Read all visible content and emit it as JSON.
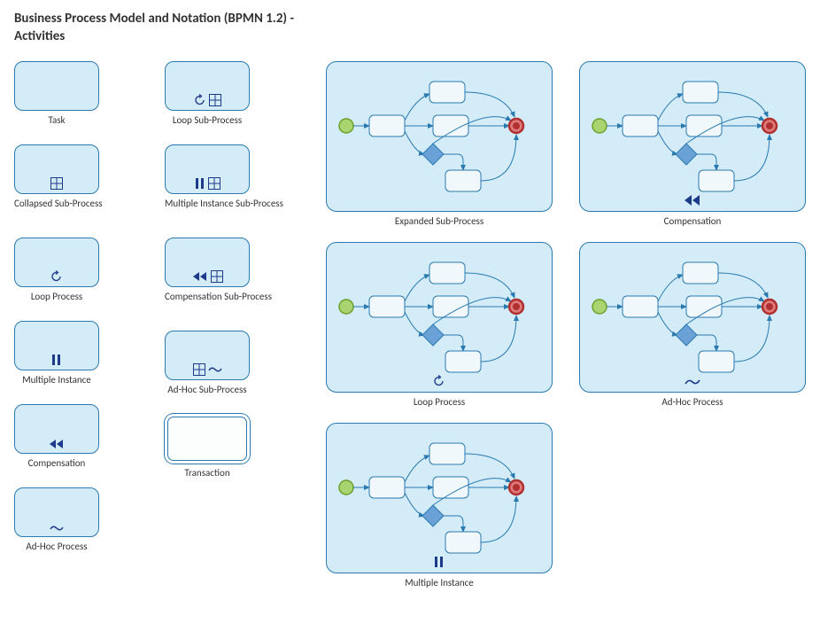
{
  "title_line1": "Business Process Model and Notation (BPMN 1.2) -",
  "title_line2": "Activities",
  "col1": {
    "task": "Task",
    "collapsed_sub": "Collapsed Sub-Process",
    "loop_process": "Loop Process",
    "multi_instance": "Multiple Instance",
    "compensation": "Compensation",
    "adhoc_process": "Ad-Hoc Process"
  },
  "col2": {
    "loop_sub": "Loop Sub-Process",
    "multi_instance_sub": "Multiple Instance Sub-Process",
    "compensation_sub": "Compensation Sub-Process",
    "adhoc_sub": "Ad-Hoc Sub-Process",
    "transaction": "Transaction"
  },
  "expanded": {
    "expanded_sub": "Expanded Sub-Process",
    "loop_process": "Loop Process",
    "multi_instance": "Multiple Instance",
    "compensation": "Compensation",
    "adhoc_process": "Ad-Hoc Process"
  },
  "colors": {
    "stroke": "#2a7ab0",
    "fill": "#d3ecf7",
    "task_fill": "#f1f8fc",
    "start": "#a9d46f",
    "start_stroke": "#6ca02a",
    "end": "#e07a7a",
    "end_stroke": "#b03030",
    "gateway": "#6aa2d8",
    "gateway_stroke": "#2a7ab0",
    "marker": "#1e3a8a"
  }
}
